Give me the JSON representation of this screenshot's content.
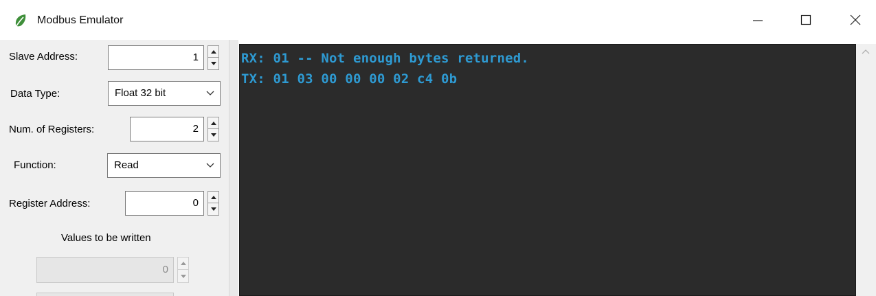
{
  "window": {
    "title": "Modbus Emulator",
    "app_icon": "leaf-icon",
    "controls": {
      "minimize_icon": "minimize-icon",
      "maximize_icon": "maximize-icon",
      "close_icon": "close-icon"
    }
  },
  "form": {
    "slave_address": {
      "label": "Slave Address:",
      "value": "1"
    },
    "data_type": {
      "label": "Data Type:",
      "value": "Float 32 bit"
    },
    "num_registers": {
      "label": "Num. of Registers:",
      "value": "2"
    },
    "function": {
      "label": "Function:",
      "value": "Read"
    },
    "register_address": {
      "label": "Register Address:",
      "value": "0"
    },
    "values_section": {
      "title": "Values to be written",
      "value_1": "0"
    }
  },
  "console": {
    "lines": [
      "RX: 01 -- Not enough bytes returned.",
      "TX: 01 03 00 00 00 02 c4 0b"
    ],
    "text_color": "#2e9ad2",
    "background": "#2b2b2b"
  }
}
